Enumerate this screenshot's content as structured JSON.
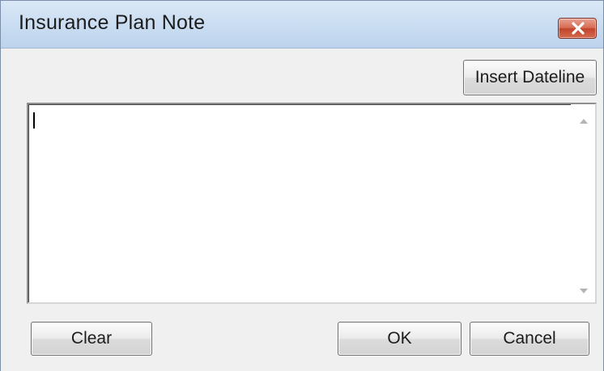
{
  "window": {
    "title": "Insurance Plan Note"
  },
  "toolbar": {
    "insert_dateline_label": "Insert Dateline"
  },
  "note": {
    "value": ""
  },
  "footer": {
    "clear_label": "Clear",
    "ok_label": "OK",
    "cancel_label": "Cancel"
  },
  "icons": {
    "close": "close-icon",
    "scroll_up": "scroll-up-arrow-icon",
    "scroll_down": "scroll-down-arrow-icon"
  },
  "colors": {
    "titlebar": "#c9dcf1",
    "close_button": "#d66a52",
    "dialog_background": "#f0f0f0"
  }
}
